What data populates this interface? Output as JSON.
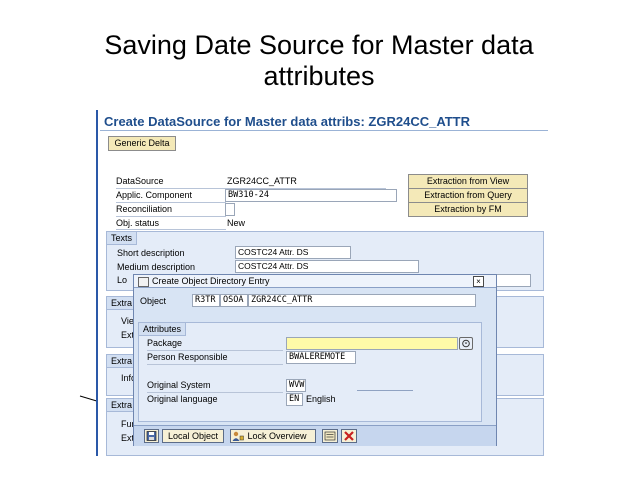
{
  "slide": {
    "title_line1": "Saving Date Source for Master data",
    "title_line2": "attributes"
  },
  "screen": {
    "header": "Create DataSource for Master data attribs: ZGR24CC_ATTR",
    "generic_delta_button": "Generic Delta",
    "fields": {
      "datasource": {
        "label": "DataSource",
        "value": "ZGR24CC_ATTR"
      },
      "appl_component": {
        "label": "Applic. Component",
        "value": "BW310-24"
      },
      "reconciliation": {
        "label": "Reconciliation"
      },
      "obj_status": {
        "label": "Obj. status",
        "value": "New"
      }
    },
    "side_buttons": [
      "Extraction from View",
      "Extraction from Query",
      "Extraction by FM"
    ],
    "texts_group": {
      "title": "Texts",
      "short_desc": {
        "label": "Short description",
        "value": "COSTC24 Attr. DS"
      },
      "medium_desc": {
        "label": "Medium description",
        "value": "COSTC24 Attr. DS"
      },
      "long_desc_label_partial": "Lo"
    },
    "hidden_groups": [
      {
        "title_partial": "Extra",
        "rows": [
          "Vie",
          "Ext"
        ]
      },
      {
        "title_partial": "Extra",
        "rows": [
          "Info"
        ]
      },
      {
        "title_partial": "Extra",
        "rows": [
          "Fun",
          "Ext"
        ]
      }
    ]
  },
  "dialog": {
    "title": "Create Object Directory Entry",
    "close_glyph": "×",
    "object": {
      "label": "Object",
      "parts": [
        "R3TR",
        "OSOA",
        "ZGR24CC_ATTR"
      ]
    },
    "attributes_title": "Attributes",
    "package": {
      "label": "Package",
      "value": ""
    },
    "person": {
      "label": "Person Responsible",
      "value": "BWALEREMOTE"
    },
    "orig_system": {
      "label": "Original System",
      "value": "WVW"
    },
    "orig_language": {
      "label": "Original language",
      "value": "EN",
      "text": "English"
    },
    "footer": {
      "local_object": "Local Object",
      "lock_overview": "Lock Overview"
    }
  }
}
